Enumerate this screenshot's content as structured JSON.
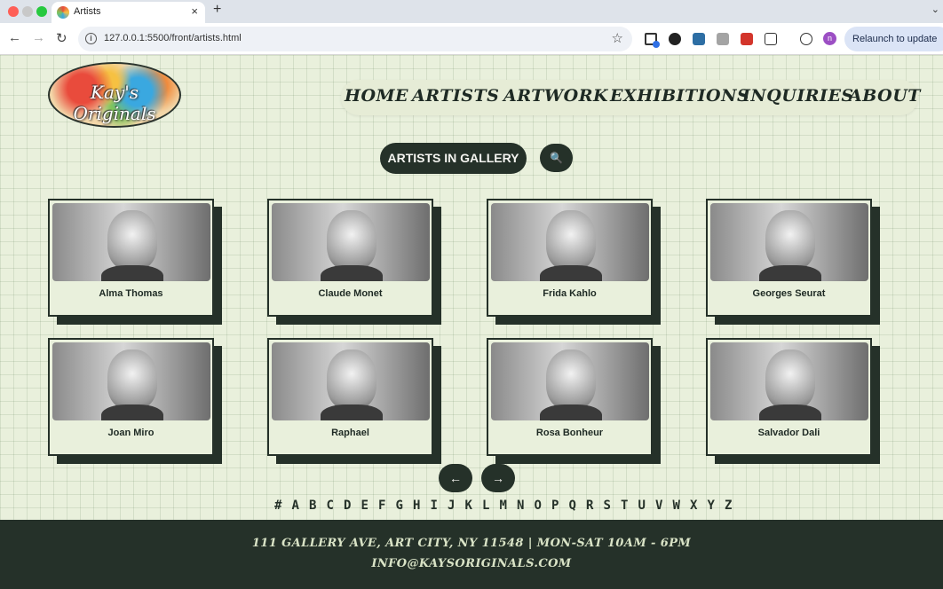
{
  "browser": {
    "tab_title": "Artists",
    "url": "127.0.0.1:5500/front/artists.html",
    "relaunch_label": "Relaunch to update",
    "profile_initial": "n"
  },
  "site": {
    "logo_text": "Kay's Originals",
    "nav": [
      "HOME",
      "ARTISTS",
      "ARTWORK",
      "EXHIBITIONS",
      "INQUIRIES",
      "ABOUT"
    ],
    "section_title": "ARTISTS IN GALLERY",
    "search_icon": "🔍",
    "prev_label": "←",
    "next_label": "→",
    "alphabet": [
      "#",
      "A",
      "B",
      "C",
      "D",
      "E",
      "F",
      "G",
      "H",
      "I",
      "J",
      "K",
      "L",
      "M",
      "N",
      "O",
      "P",
      "Q",
      "R",
      "S",
      "T",
      "U",
      "V",
      "W",
      "X",
      "Y",
      "Z"
    ],
    "footer_address": "111 GALLERY AVE, ART CITY, NY 11548 | MON-SAT 10AM - 6PM",
    "footer_email": "INFO@KAYSORIGINALS.COM"
  },
  "artists": [
    {
      "name": "Alma Thomas"
    },
    {
      "name": "Claude Monet"
    },
    {
      "name": "Frida Kahlo"
    },
    {
      "name": "Georges Seurat"
    },
    {
      "name": "Joan Miro"
    },
    {
      "name": "Raphael"
    },
    {
      "name": "Rosa Bonheur"
    },
    {
      "name": "Salvador Dali"
    }
  ]
}
